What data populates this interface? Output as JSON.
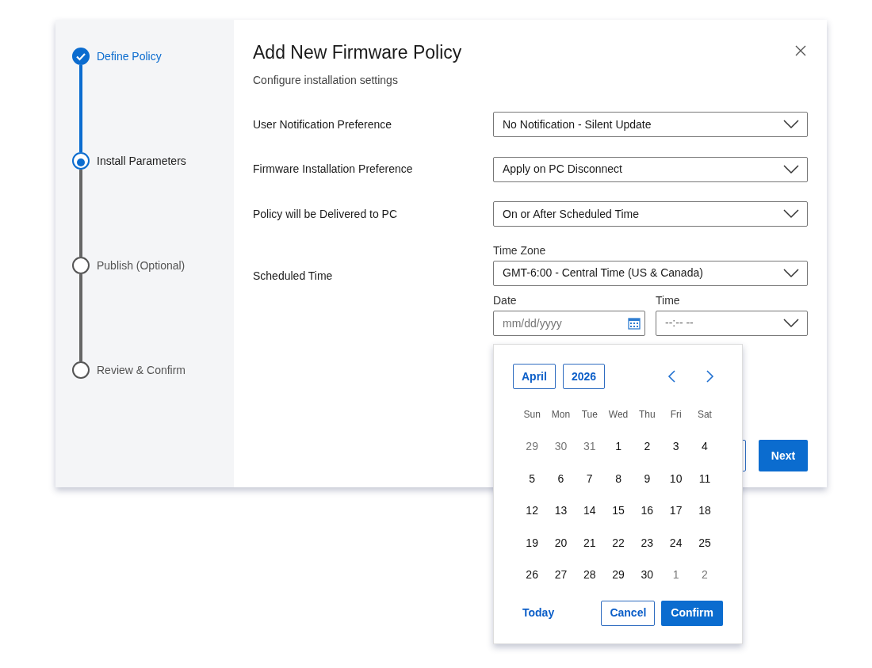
{
  "steps": [
    {
      "label": "Define Policy",
      "completed": true,
      "selected": false
    },
    {
      "label": "Install Parameters",
      "completed": false,
      "selected": true
    },
    {
      "label": "Publish (Optional)",
      "completed": false,
      "selected": false
    },
    {
      "label": "Review & Confirm",
      "completed": false,
      "selected": false
    }
  ],
  "dialog": {
    "title": "Add New Firmware Policy",
    "subtitle": "Configure installation settings"
  },
  "settings": [
    {
      "label": "User Notification Preference",
      "value": "No Notification - Silent Update"
    },
    {
      "label": "Firmware Installation Preference",
      "value": "Apply on PC Disconnect"
    },
    {
      "label": "Policy will be Delivered to PC",
      "value": "On or After Scheduled Time"
    }
  ],
  "scheduled_time": {
    "label": "Scheduled Time",
    "time_zone_label": "Time Zone",
    "time_zone": "GMT-6:00 - Central Time (US & Canada)",
    "date_label": "Date",
    "date_placeholder": "mm/dd/yyyy",
    "time_label": "Time",
    "time_placeholder": "--:-- --"
  },
  "next_button": "Next",
  "calendar": {
    "month": "April",
    "year": "2026",
    "weekdays": [
      "Sun",
      "Mon",
      "Tue",
      "Wed",
      "Thu",
      "Fri",
      "Sat"
    ],
    "weeks": [
      [
        {
          "day": "29",
          "muted": true
        },
        {
          "day": "30",
          "muted": true
        },
        {
          "day": "31",
          "muted": true
        },
        {
          "day": "1",
          "muted": false
        },
        {
          "day": "2",
          "muted": false
        },
        {
          "day": "3",
          "muted": false
        },
        {
          "day": "4",
          "muted": false
        }
      ],
      [
        {
          "day": "5",
          "muted": false
        },
        {
          "day": "6",
          "muted": false
        },
        {
          "day": "7",
          "muted": false
        },
        {
          "day": "8",
          "muted": false
        },
        {
          "day": "9",
          "muted": false
        },
        {
          "day": "10",
          "muted": false
        },
        {
          "day": "11",
          "muted": false
        }
      ],
      [
        {
          "day": "12",
          "muted": false
        },
        {
          "day": "13",
          "muted": false
        },
        {
          "day": "14",
          "muted": false
        },
        {
          "day": "15",
          "muted": false
        },
        {
          "day": "16",
          "muted": false
        },
        {
          "day": "17",
          "muted": false
        },
        {
          "day": "18",
          "muted": false
        }
      ],
      [
        {
          "day": "19",
          "muted": false
        },
        {
          "day": "20",
          "muted": false
        },
        {
          "day": "21",
          "muted": false
        },
        {
          "day": "22",
          "muted": false
        },
        {
          "day": "23",
          "muted": false
        },
        {
          "day": "24",
          "muted": false
        },
        {
          "day": "25",
          "muted": false
        }
      ],
      [
        {
          "day": "26",
          "muted": false
        },
        {
          "day": "27",
          "muted": false
        },
        {
          "day": "28",
          "muted": false
        },
        {
          "day": "29",
          "muted": false
        },
        {
          "day": "30",
          "muted": false
        },
        {
          "day": "1",
          "muted": true
        },
        {
          "day": "2",
          "muted": true
        }
      ]
    ],
    "today": "Today",
    "cancel": "Cancel",
    "confirm": "Confirm"
  }
}
